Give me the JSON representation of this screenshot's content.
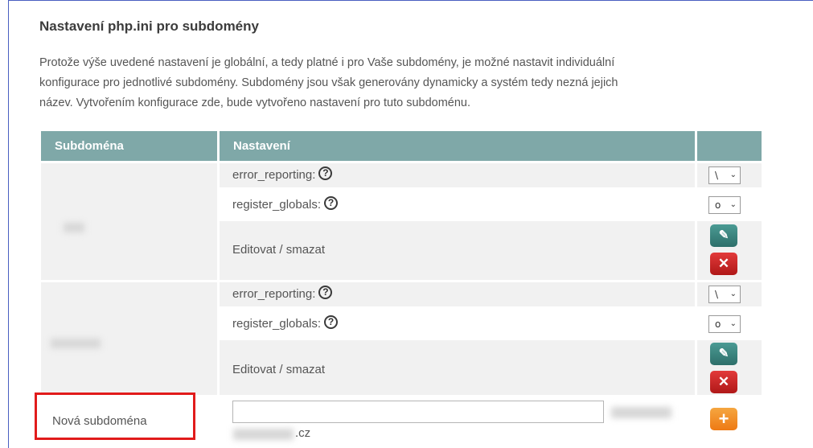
{
  "section": {
    "title": "Nastavení php.ini pro subdomény",
    "description": [
      "Protože výše uvedené nastavení je globální, a tedy platné i pro Vaše subdomény, je možné nastavit individuální",
      "konfigurace pro jednotlivé subdomény. Subdomény jsou však generovány dynamicky a systém tedy nezná jejich",
      "název. Vytvořením konfigurace zde, bude vytvořeno nastavení pro tuto subdoménu."
    ]
  },
  "table": {
    "headers": [
      "Subdoména",
      "Nastavení",
      ""
    ],
    "help_glyph": "?",
    "rows": [
      {
        "settings": [
          {
            "label": "error_reporting:",
            "select_value": "\\",
            "caret": "⌄"
          },
          {
            "label": "register_globals:",
            "select_value": "o",
            "caret": "⌄"
          }
        ],
        "action_label": "Editovat / smazat",
        "edit_icon": "✎",
        "delete_icon": "✕"
      },
      {
        "settings": [
          {
            "label": "error_reporting:",
            "select_value": "\\",
            "caret": "⌄"
          },
          {
            "label": "register_globals:",
            "select_value": "o",
            "caret": "⌄"
          }
        ],
        "action_label": "Editovat / smazat",
        "edit_icon": "✎",
        "delete_icon": "✕"
      }
    ],
    "new_row": {
      "label": "Nová subdoména",
      "input_value": "",
      "domain_suffix": ".cz",
      "add_icon": "+"
    }
  },
  "colors": {
    "header_bg": "#7fa8a8",
    "edit_button": "#2d6f6a",
    "delete_button": "#c42020",
    "add_button": "#f0861e",
    "highlight_box": "#e11b1b"
  }
}
